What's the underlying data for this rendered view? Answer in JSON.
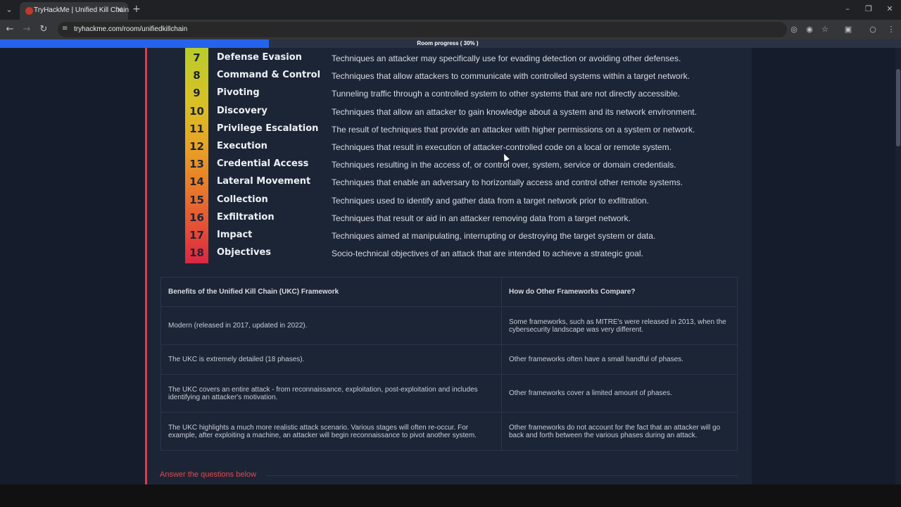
{
  "browser": {
    "tab_title": "TryHackMe | Unified Kill Chain",
    "url": "tryhackme.com/room/unifiedkillchain",
    "icons": {
      "tab_list": "chevron-down-icon",
      "close_tab": "close-icon",
      "new_tab": "plus-icon",
      "back": "arrow-left-icon",
      "forward": "arrow-right-icon",
      "reload": "reload-icon"
    }
  },
  "progress": {
    "label": "Room progress ( 30% )",
    "percent": 30,
    "fill_color": "#2563eb"
  },
  "phases": [
    {
      "num": "7",
      "name": "Defense Evasion",
      "desc": "Techniques an attacker may specifically use for evading detection or avoiding other defenses."
    },
    {
      "num": "8",
      "name": "Command & Control",
      "desc": "Techniques that allow attackers to communicate with controlled systems within a target network."
    },
    {
      "num": "9",
      "name": "Pivoting",
      "desc": "Tunneling traffic through a controlled system to other systems that are not directly accessible."
    },
    {
      "num": "10",
      "name": "Discovery",
      "desc": "Techniques that allow an attacker to gain knowledge about a system and its network environment."
    },
    {
      "num": "11",
      "name": "Privilege Escalation",
      "desc": "The result of techniques that provide an attacker with higher permissions on a system or network."
    },
    {
      "num": "12",
      "name": "Execution",
      "desc": "Techniques that result in execution of attacker-controlled code on a local or remote system."
    },
    {
      "num": "13",
      "name": "Credential Access",
      "desc": "Techniques resulting in the access of, or control over, system, service or domain credentials."
    },
    {
      "num": "14",
      "name": "Lateral Movement",
      "desc": "Techniques that enable an adversary to horizontally access and control other remote systems."
    },
    {
      "num": "15",
      "name": "Collection",
      "desc": "Techniques used to identify and gather data from a target network prior to exfiltration."
    },
    {
      "num": "16",
      "name": "Exfiltration",
      "desc": "Techniques that result or aid in an attacker removing data from a target network."
    },
    {
      "num": "17",
      "name": "Impact",
      "desc": "Techniques aimed at manipulating, interrupting or destroying the target system or data."
    },
    {
      "num": "18",
      "name": "Objectives",
      "desc": "Socio-technical objectives of an attack that are intended to achieve a strategic goal."
    }
  ],
  "comparison": {
    "headers": [
      "Benefits of the Unified Kill Chain (UKC) Framework",
      "How do Other Frameworks Compare?"
    ],
    "rows": [
      [
        "Modern (released in 2017, updated in 2022).",
        "Some frameworks, such as MITRE's were released in 2013, when the cybersecurity landscape was very different."
      ],
      [
        "The UKC is extremely detailed (18 phases).",
        "Other frameworks often have a small handful of phases."
      ],
      [
        "The UKC covers an entire attack - from reconnaissance, exploitation, post-exploitation and includes identifying an attacker's motivation.",
        "Other frameworks cover a limited amount of phases."
      ],
      [
        "The UKC highlights a much more realistic attack scenario. Various stages will often re-occur. For example, after exploiting a machine, an attacker will begin reconnaissance to pivot another system.",
        "Other frameworks do not account for the fact that an attacker will go back and forth between the various phases during an attack."
      ]
    ]
  },
  "answer_heading": "Answer the questions below"
}
